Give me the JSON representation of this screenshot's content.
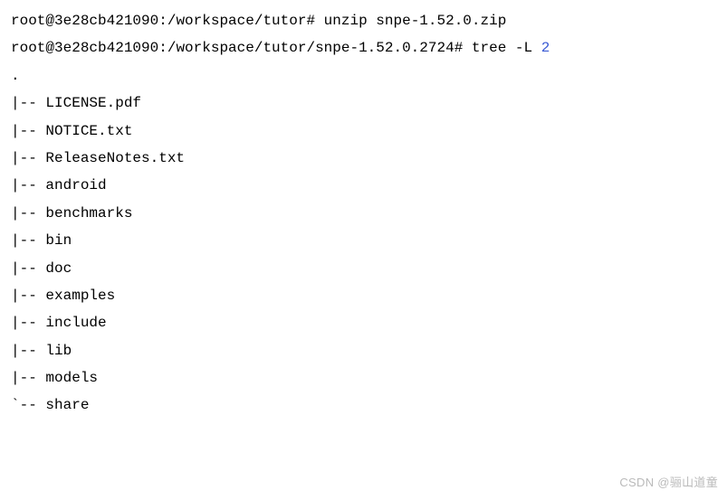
{
  "lines": {
    "prompt1_user": "root@3e28cb421090",
    "prompt1_path": ":/workspace/tutor# ",
    "prompt1_cmd": "unzip snpe-1.52.0.zip",
    "prompt2_user": "root@3e28cb421090",
    "prompt2_path": ":/workspace/tutor/snpe-1.52.0.2724# ",
    "prompt2_cmd": "tree -L ",
    "prompt2_arg": "2",
    "tree_root": ".",
    "branch_mid": "|-- ",
    "branch_last": "`-- ",
    "entries": {
      "e0": "LICENSE.pdf",
      "e1": "NOTICE.txt",
      "e2": "ReleaseNotes.txt",
      "e3": "android",
      "e4": "benchmarks",
      "e5": "bin",
      "e6": "doc",
      "e7": "examples",
      "e8": "include",
      "e9": "lib",
      "e10": "models",
      "e11": "share"
    }
  },
  "watermark": "CSDN @骊山道童"
}
